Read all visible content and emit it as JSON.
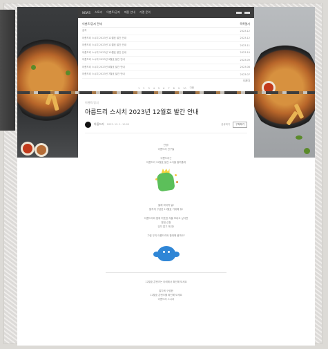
{
  "nav": {
    "items": [
      "NEWS",
      "스토리",
      "이벤트/공지",
      "매장 안내",
      "가맹 문의"
    ]
  },
  "list": {
    "header_left": "이벤트/공지 전체",
    "header_right": "목록열기",
    "items": [
      {
        "title": "공지",
        "date": "2023.12"
      },
      {
        "title": "아름드리 스시치 2023년 12월호 발간 안내",
        "date": "2023.12"
      },
      {
        "title": "아름드리 스시치 2023년 11월호 발간 안내",
        "date": "2023.11"
      },
      {
        "title": "아름드리 스시치 2023년 10월호 발간 안내",
        "date": "2023.10"
      },
      {
        "title": "아름드리 스시치 2023년 9월호 발간 안내",
        "date": "2023.09"
      },
      {
        "title": "아름드리 스시치 2023년 8월호 발간 안내",
        "date": "2023.08"
      },
      {
        "title": "아름드리 스시치 2023년 7월호 발간 안내",
        "date": "2023.07"
      }
    ],
    "more": "더보기",
    "pages": [
      "1",
      "2",
      "3",
      "4",
      "5",
      "6",
      "7",
      "8",
      "9",
      "10",
      "다음"
    ]
  },
  "post": {
    "category": "이벤트/공지",
    "title": "아름드리 스시치 2023년 12월호 발간 안내",
    "author": "아름드리",
    "date": "2023. 12. 1. 10:00",
    "share": "공유하기",
    "subscribe": "구독하기"
  },
  "body": {
    "block1": [
      "안녕!",
      "아름드리 친구들",
      "",
      "아름드리는",
      "아름드리 12월호 발간 소식을 알려줄게"
    ],
    "block2": [
      "올해 마지막 달!",
      "알차게 구성한 12월호 기대해 줘!",
      "",
      "아름드리와 함께 따뜻한 겨울 보내고 싶다면",
      "알림 신청",
      "잊지 말고 해 줘!",
      "",
      "그럼 우리 아름드리와 함께해 볼까요?"
    ],
    "block3": [
      "12월호 콘텐츠는 아래에서 확인해 보세요",
      "",
      "알차게 구성한",
      "12월호 콘텐츠를 확인해 보세요",
      "아름드리 스시치"
    ]
  }
}
